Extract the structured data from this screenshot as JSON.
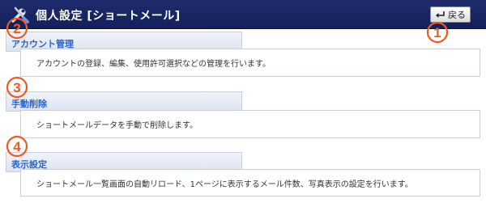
{
  "header": {
    "title": "個人設定 [ショートメール]",
    "icon": "tools-icon",
    "back_button_label": "戻る",
    "back_icon": "return-arrow-icon",
    "background_color": "#1a2663"
  },
  "sections": [
    {
      "title": "アカウント管理",
      "description": "アカウントの登録、編集、使用許可選択などの管理を行います。"
    },
    {
      "title": "手動削除",
      "description": "ショートメールデータを手動で削除します。"
    },
    {
      "title": "表示設定",
      "description": "ショートメール一覧画面の自動リロード、1ページに表示するメール件数、写真表示の設定を行います。"
    }
  ],
  "annotations": {
    "color": "#f05a1e",
    "markers": [
      "1",
      "2",
      "3",
      "4"
    ]
  },
  "colors": {
    "section_title_text": "#2a64c8",
    "annotation": "#f05a1e"
  }
}
